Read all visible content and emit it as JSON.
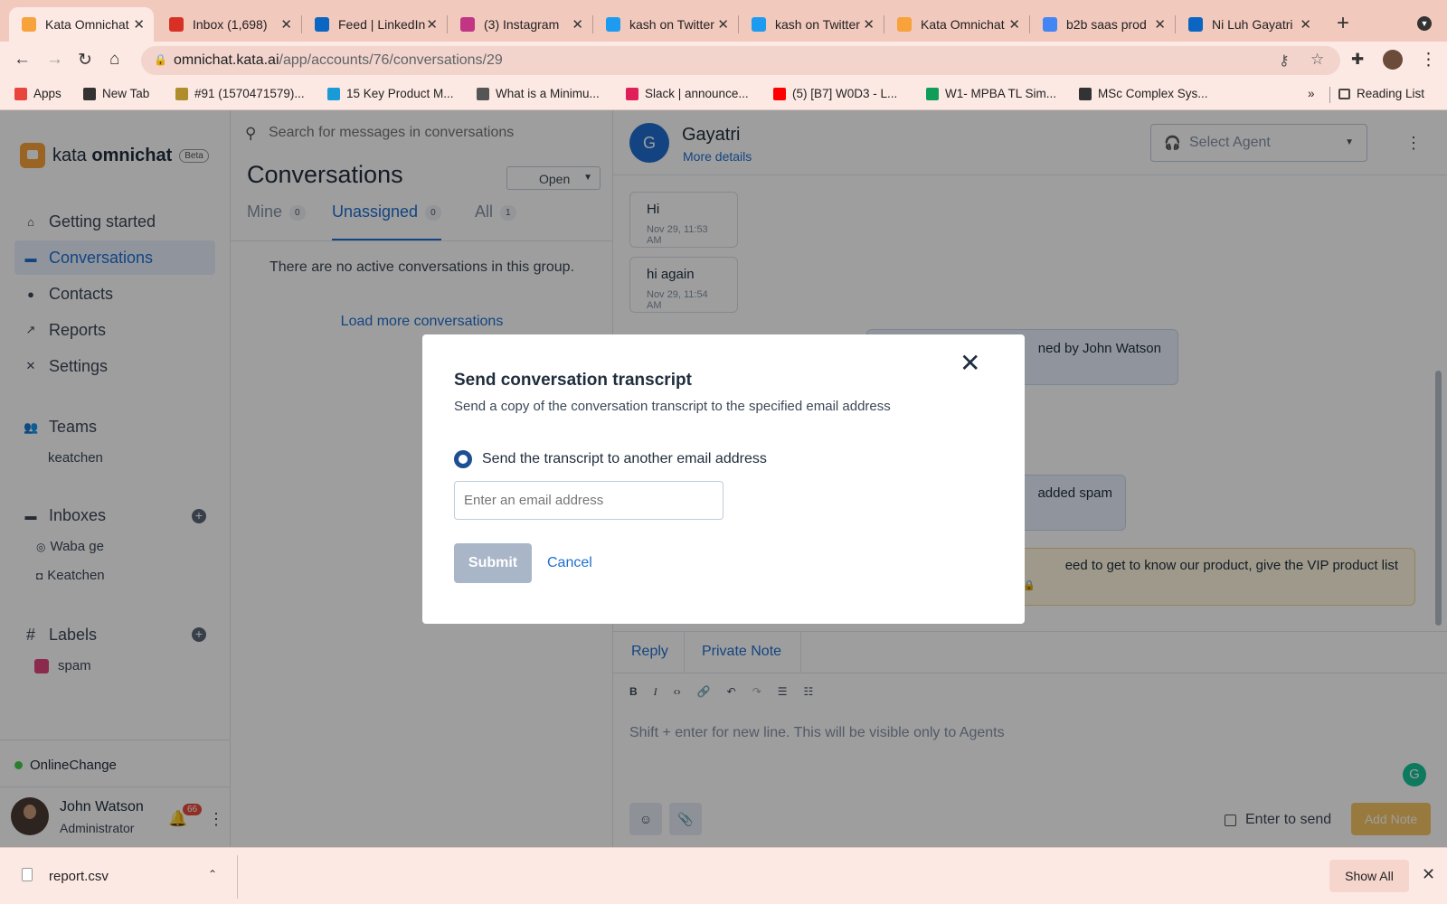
{
  "browser": {
    "tabs": [
      {
        "title": "Kata Omnichat",
        "favicon": "kata-icon",
        "color": "#f7a23a",
        "active": true
      },
      {
        "title": "Inbox (1,698)",
        "favicon": "gmail-icon",
        "color": "#d93025"
      },
      {
        "title": "Feed | LinkedIn",
        "favicon": "linkedin-icon",
        "color": "#0a66c2"
      },
      {
        "title": "(3) Instagram",
        "favicon": "instagram-icon",
        "color": "#c13584"
      },
      {
        "title": "kash on Twitter",
        "favicon": "twitter-icon",
        "color": "#1d9bf0"
      },
      {
        "title": "kash on Twitter",
        "favicon": "twitter-icon",
        "color": "#1d9bf0"
      },
      {
        "title": "Kata Omnichat",
        "favicon": "kata-icon",
        "color": "#f7a23a"
      },
      {
        "title": "b2b saas prod",
        "favicon": "google-icon",
        "color": "#4285f4"
      },
      {
        "title": "Ni Luh Gayatri",
        "favicon": "linkedin-icon",
        "color": "#0a66c2"
      }
    ],
    "url_host": "omnichat.kata.ai",
    "url_path": "/app/accounts/76/conversations/29",
    "bookmarks": [
      {
        "label": "Apps",
        "icon": "apps-grid-icon",
        "color": "#e8453c"
      },
      {
        "label": "New Tab",
        "icon": "new-tab-icon",
        "color": "#333"
      },
      {
        "label": "#91 (1570471579)...",
        "icon": "bookmark-favicon",
        "color": "#b08d2c"
      },
      {
        "label": "15 Key Product M...",
        "icon": "bookmark-favicon",
        "color": "#1a9bd7"
      },
      {
        "label": "What is a Minimu...",
        "icon": "bookmark-favicon",
        "color": "#555"
      },
      {
        "label": "Slack | announce...",
        "icon": "slack-icon",
        "color": "#e01e5a"
      },
      {
        "label": "(5) [B7] W0D3 - L...",
        "icon": "youtube-icon",
        "color": "#ff0000"
      },
      {
        "label": "W1- MPBA TL Sim...",
        "icon": "sheets-icon",
        "color": "#0f9d58"
      },
      {
        "label": "MSc Complex Sys...",
        "icon": "bookmark-favicon",
        "color": "#333"
      }
    ],
    "more_bookmarks": "»",
    "reading_list": "Reading List"
  },
  "sidebar": {
    "brand_regular": "kata ",
    "brand_bold": "omnichat",
    "beta": "Beta",
    "nav": [
      {
        "label": "Getting started",
        "icon": "home-icon"
      },
      {
        "label": "Conversations",
        "icon": "chat-icon",
        "active": true
      },
      {
        "label": "Contacts",
        "icon": "person-icon"
      },
      {
        "label": "Reports",
        "icon": "trend-icon"
      },
      {
        "label": "Settings",
        "icon": "tools-icon"
      }
    ],
    "teams_label": "Teams",
    "teams": [
      "keatchen"
    ],
    "inboxes_label": "Inboxes",
    "inboxes": [
      {
        "label": "Waba ge",
        "icon": "whatsapp-icon"
      },
      {
        "label": "Keatchen",
        "icon": "instagram-icon"
      }
    ],
    "labels_label": "Labels",
    "labels": [
      {
        "label": "spam",
        "color": "#e0457b"
      }
    ],
    "status": "Online",
    "status_change": "Change",
    "user_name": "John Watson",
    "user_role": "Administrator",
    "notification_count": "66"
  },
  "convlist": {
    "search_placeholder": "Search for messages in conversations",
    "title": "Conversations",
    "status_filter": "Open",
    "tabs": [
      {
        "label": "Mine",
        "count": "0"
      },
      {
        "label": "Unassigned",
        "count": "0",
        "active": true
      },
      {
        "label": "All",
        "count": "1"
      }
    ],
    "empty_message": "There are no active conversations in this group.",
    "load_more": "Load more conversations"
  },
  "chat": {
    "contact_initial": "G",
    "contact_name": "Gayatri",
    "more_details": "More details",
    "select_agent": "Select Agent",
    "messages": [
      {
        "text": "Hi",
        "time": "Nov 29, 11:53 AM"
      },
      {
        "text": "hi again",
        "time": "Nov 29, 11:54 AM"
      }
    ],
    "activity_1": "ned by John Watson",
    "activity_2": "added spam",
    "note_text": "eed to get to know our product, give the VIP product list",
    "reply_tabs": [
      "Reply",
      "Private Note"
    ],
    "editor_placeholder": "Shift + enter for new line. This will be visible only to Agents",
    "enter_to_send": "Enter to send",
    "add_note": "Add Note"
  },
  "modal": {
    "title": "Send conversation transcript",
    "description": "Send a copy of the conversation transcript to the specified email address",
    "option_label": "Send the transcript to another email address",
    "email_placeholder": "Enter an email address",
    "submit": "Submit",
    "cancel": "Cancel"
  },
  "downloads": {
    "file": "report.csv",
    "show_all": "Show All"
  }
}
